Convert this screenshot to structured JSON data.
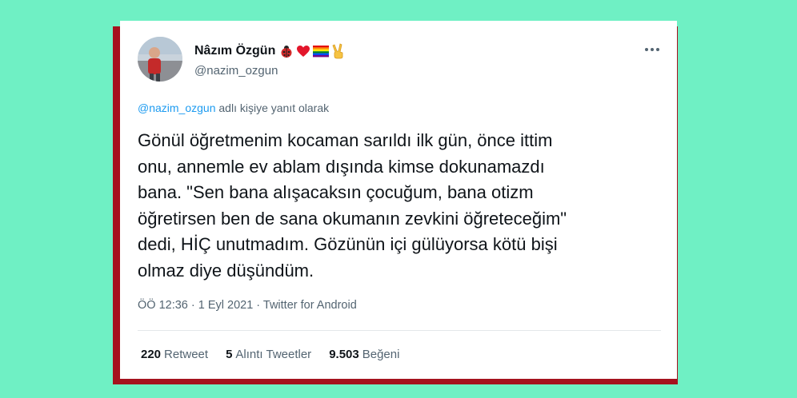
{
  "tweet": {
    "author": {
      "display_name": "Nâzım Özgün",
      "handle": "@nazim_ozgun",
      "name_emojis": [
        "ladybug-icon",
        "red-heart-icon",
        "rainbow-flag-icon",
        "victory-hand-icon"
      ]
    },
    "reply_to": {
      "mention": "@nazim_ozgun",
      "suffix": " adlı kişiye yanıt olarak"
    },
    "text": "Gönül öğretmenim kocaman sarıldı ilk gün, önce ittim\nonu, annemle ev ablam dışında kimse dokunamazdı\nbana. \"Sen bana alışacaksın çocuğum, bana otizm\nöğretirsen ben de sana okumanın zevkini öğreteceğim\"\ndedi, HİÇ unutmadım. Gözünün içi gülüyorsa kötü bişi\nolmaz diye düşündüm.",
    "timestamp": "ÖÖ 12:36 · 1 Eyl 2021 · Twitter for Android",
    "stats": [
      {
        "count": "220",
        "label": "Retweet"
      },
      {
        "count": "5",
        "label": "Alıntı Tweetler"
      },
      {
        "count": "9.503",
        "label": "Beğeni"
      }
    ]
  },
  "colors": {
    "background": "#6ff0c4",
    "card_shadow": "#a5121e",
    "mention": "#1d9bf0",
    "secondary_text": "#536471"
  }
}
